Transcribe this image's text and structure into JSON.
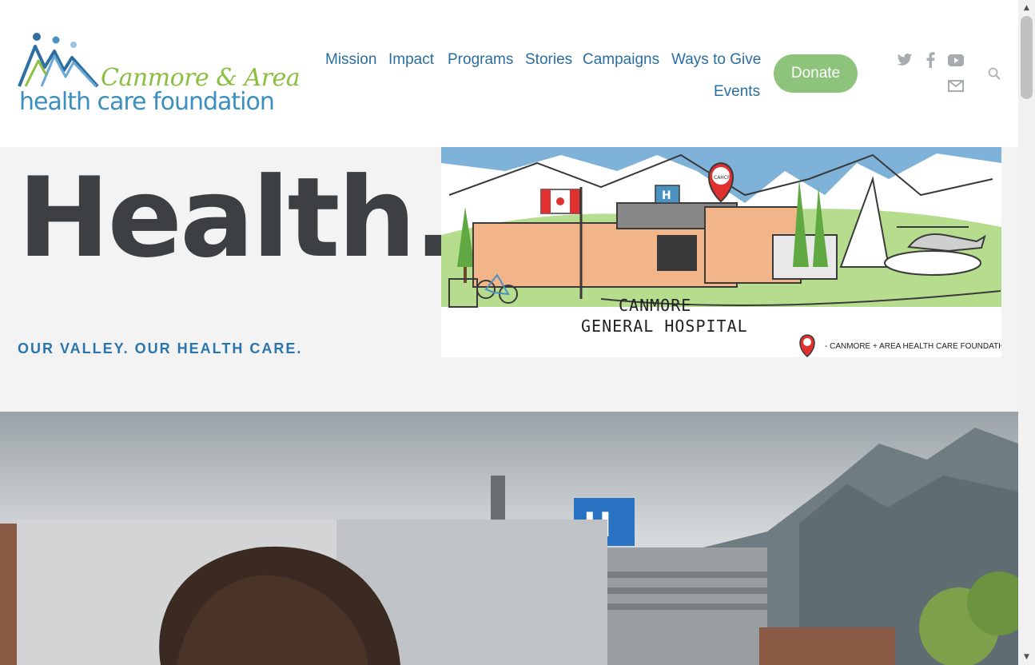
{
  "header": {
    "logo": {
      "line1": "Canmore & Area",
      "line2": "health care foundation"
    },
    "nav": [
      {
        "label": "Mission"
      },
      {
        "label": "Impact"
      },
      {
        "label": "Programs"
      },
      {
        "label": "Stories"
      },
      {
        "label": "Campaigns"
      },
      {
        "label": "Ways to Give"
      },
      {
        "label": "Events"
      }
    ],
    "donate_label": "Donate",
    "social_icons": [
      "twitter-icon",
      "facebook-icon",
      "youtube-icon",
      "email-icon"
    ],
    "search_icon": "search-icon"
  },
  "hero": {
    "heading": "Health.",
    "tagline": "OUR VALLEY. OUR HEALTH CARE.",
    "illustration": {
      "sign_line1": "CANMORE",
      "sign_line2": "GENERAL HOSPITAL",
      "pin_label": "CAHCF",
      "caption": "- CANMORE + AREA HEALTH CARE FOUNDATION"
    }
  },
  "colors": {
    "nav_blue": "#2a6ea1",
    "donate_green": "#8dc37a",
    "heading_gray": "#3d4042",
    "tagline_blue": "#2a76ac",
    "logo_green": "#8cbf3f",
    "logo_blue": "#3b8fbf"
  }
}
